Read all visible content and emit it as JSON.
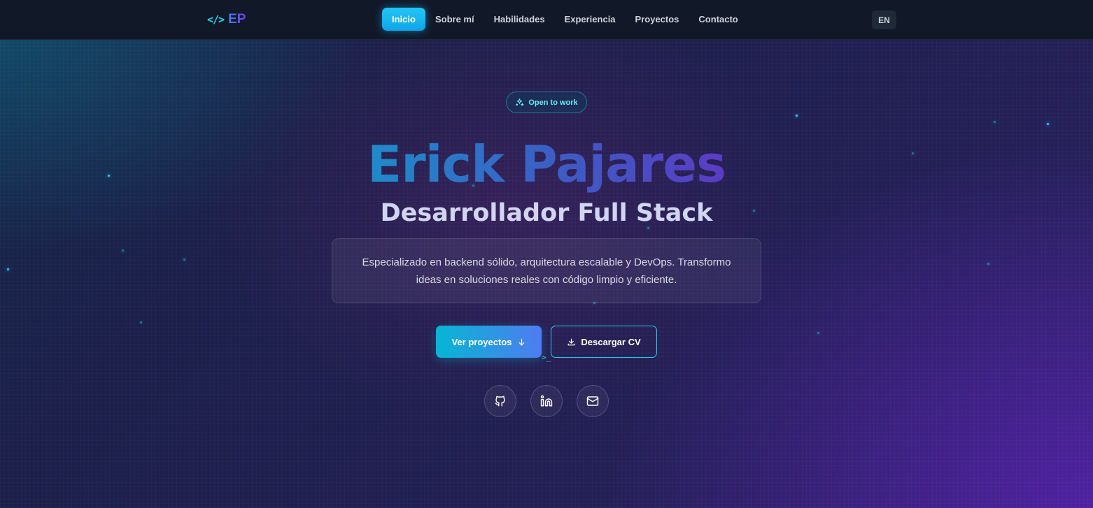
{
  "nav": {
    "logo_text": "EP",
    "logo_icon": "code-icon",
    "links": [
      {
        "label": "Inicio",
        "active": true
      },
      {
        "label": "Sobre mí",
        "active": false
      },
      {
        "label": "Habilidades",
        "active": false
      },
      {
        "label": "Experiencia",
        "active": false
      },
      {
        "label": "Proyectos",
        "active": false
      },
      {
        "label": "Contacto",
        "active": false
      }
    ],
    "lang_label": "EN"
  },
  "hero": {
    "badge": "Open to work",
    "badge_icon": "sparkles-icon",
    "name": "Erick Pajares",
    "title": "Desarrollador Full Stack",
    "description": "Especializado en backend sólido, arquitectura escalable y DevOps. Transformo ideas en soluciones reales con código limpio y eficiente.",
    "primary_button": "Ver proyectos",
    "primary_button_icon": "arrow-down-icon",
    "secondary_button": "Descargar CV",
    "secondary_button_icon": "download-icon",
    "prompt_mark": ">_",
    "social": [
      {
        "icon": "github-icon"
      },
      {
        "icon": "linkedin-icon"
      },
      {
        "icon": "mail-icon"
      }
    ]
  },
  "colors": {
    "accent": "#22d3ee",
    "active_nav": "#0ea5e9",
    "nav_bg": "#111827",
    "gradient_start": "#06b6d4",
    "gradient_end": "#7c3aed"
  }
}
